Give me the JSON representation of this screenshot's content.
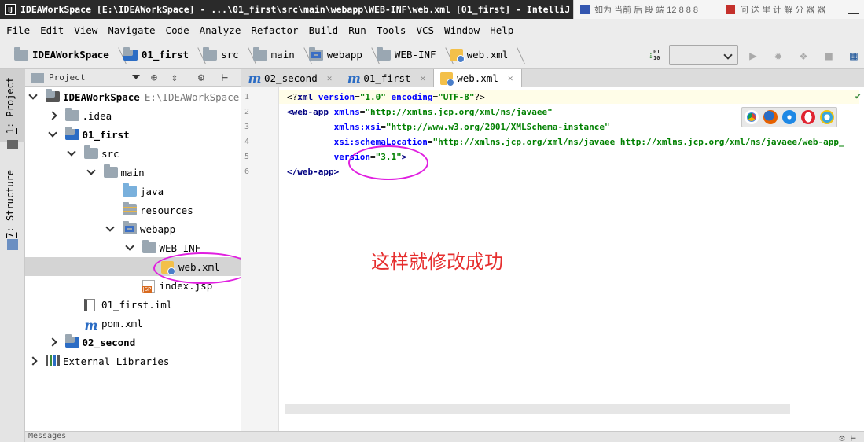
{
  "window": {
    "title": "IDEAWorkSpace [E:\\IDEAWorkSpace] - ...\\01_first\\src\\main\\webapp\\WEB-INF\\web.xml [01_first] - IntelliJ IDEA",
    "app_icon_label": "IJ",
    "background_tabs": [
      "如为 当前 后 段 端 12 8 8 8",
      "问 送 里 计 解 分 器 器"
    ]
  },
  "menu": {
    "items": [
      {
        "label": "File",
        "mnemonic": "F"
      },
      {
        "label": "Edit",
        "mnemonic": "E"
      },
      {
        "label": "View",
        "mnemonic": "V"
      },
      {
        "label": "Navigate",
        "mnemonic": "N"
      },
      {
        "label": "Code",
        "mnemonic": "C"
      },
      {
        "label": "Analyze",
        "mnemonic": "z"
      },
      {
        "label": "Refactor",
        "mnemonic": "R"
      },
      {
        "label": "Build",
        "mnemonic": "B"
      },
      {
        "label": "Run",
        "mnemonic": "u"
      },
      {
        "label": "Tools",
        "mnemonic": "T"
      },
      {
        "label": "VCS",
        "mnemonic": "S"
      },
      {
        "label": "Window",
        "mnemonic": "W"
      },
      {
        "label": "Help",
        "mnemonic": "H"
      }
    ]
  },
  "breadcrumbs": [
    {
      "label": "IDEAWorkSpace",
      "bold": true,
      "icon": "folder-icon"
    },
    {
      "label": "01_first",
      "bold": true,
      "icon": "module-folder-icon"
    },
    {
      "label": "src",
      "bold": false,
      "icon": "folder-icon"
    },
    {
      "label": "main",
      "bold": false,
      "icon": "folder-icon"
    },
    {
      "label": "webapp",
      "bold": false,
      "icon": "web-folder-icon"
    },
    {
      "label": "WEB-INF",
      "bold": false,
      "icon": "folder-icon"
    },
    {
      "label": "web.xml",
      "bold": false,
      "icon": "xml-file-icon"
    }
  ],
  "tool_windows": {
    "project_tab": {
      "number": "1",
      "label": ": Project"
    },
    "structure_tab": {
      "number": "7",
      "label": ": Structure"
    }
  },
  "project_panel": {
    "title": "Project",
    "tree": [
      {
        "label": "IDEAWorkSpace",
        "path": "E:\\IDEAWorkSpace",
        "depth": 0,
        "expanded": true,
        "bold": true,
        "icon": "project-folder-icon"
      },
      {
        "label": ".idea",
        "depth": 1,
        "expanded": false,
        "bold": false,
        "icon": "folder-icon"
      },
      {
        "label": "01_first",
        "depth": 1,
        "expanded": true,
        "bold": true,
        "icon": "module-folder-icon"
      },
      {
        "label": "src",
        "depth": 2,
        "expanded": true,
        "bold": false,
        "icon": "folder-icon"
      },
      {
        "label": "main",
        "depth": 3,
        "expanded": true,
        "bold": false,
        "icon": "folder-icon"
      },
      {
        "label": "java",
        "depth": 4,
        "expanded": null,
        "bold": false,
        "icon": "source-folder-icon"
      },
      {
        "label": "resources",
        "depth": 4,
        "expanded": null,
        "bold": false,
        "icon": "resources-folder-icon"
      },
      {
        "label": "webapp",
        "depth": 4,
        "expanded": true,
        "bold": false,
        "icon": "web-folder-icon"
      },
      {
        "label": "WEB-INF",
        "depth": 5,
        "expanded": true,
        "bold": false,
        "icon": "folder-icon"
      },
      {
        "label": "web.xml",
        "depth": 6,
        "expanded": null,
        "bold": false,
        "icon": "xml-file-icon",
        "selected": true
      },
      {
        "label": "index.jsp",
        "depth": 5,
        "expanded": null,
        "bold": false,
        "icon": "jsp-file-icon"
      },
      {
        "label": "01_first.iml",
        "depth": 2,
        "expanded": null,
        "bold": false,
        "icon": "iml-file-icon"
      },
      {
        "label": "pom.xml",
        "depth": 2,
        "expanded": null,
        "bold": false,
        "icon": "maven-icon"
      },
      {
        "label": "02_second",
        "depth": 1,
        "expanded": false,
        "bold": true,
        "icon": "module-folder-icon"
      },
      {
        "label": "External Libraries",
        "depth": 0,
        "expanded": false,
        "bold": false,
        "icon": "library-icon"
      }
    ]
  },
  "editor_tabs": [
    {
      "label": "02_second",
      "icon": "maven-icon",
      "active": false
    },
    {
      "label": "01_first",
      "icon": "maven-icon",
      "active": false
    },
    {
      "label": "web.xml",
      "icon": "xml-file-icon",
      "active": true
    }
  ],
  "editor": {
    "line_numbers": [
      "1",
      "2",
      "3",
      "4",
      "5",
      "6"
    ],
    "lines": [
      [
        {
          "t": "pi",
          "s": "<?"
        },
        {
          "t": "tag",
          "s": "xml "
        },
        {
          "t": "attr",
          "s": "version"
        },
        {
          "t": "pi",
          "s": "="
        },
        {
          "t": "val",
          "s": "\"1.0\""
        },
        {
          "t": "pi",
          "s": " "
        },
        {
          "t": "attr",
          "s": "encoding"
        },
        {
          "t": "pi",
          "s": "="
        },
        {
          "t": "val",
          "s": "\"UTF-8\""
        },
        {
          "t": "pi",
          "s": "?>"
        }
      ],
      [
        {
          "t": "tag",
          "s": "<web-app "
        },
        {
          "t": "attr",
          "s": "xmlns"
        },
        {
          "t": "pi",
          "s": "="
        },
        {
          "t": "val",
          "s": "\"http://xmlns.jcp.org/xml/ns/javaee\""
        }
      ],
      [
        {
          "t": "pi",
          "s": "         "
        },
        {
          "t": "attr",
          "s": "xmlns:xsi"
        },
        {
          "t": "pi",
          "s": "="
        },
        {
          "t": "val",
          "s": "\"http://www.w3.org/2001/XMLSchema-instance\""
        }
      ],
      [
        {
          "t": "pi",
          "s": "         "
        },
        {
          "t": "attr",
          "s": "xsi:schemaLocation"
        },
        {
          "t": "pi",
          "s": "="
        },
        {
          "t": "val",
          "s": "\"http://xmlns.jcp.org/xml/ns/javaee http://xmlns.jcp.org/xml/ns/javaee/web-app_"
        }
      ],
      [
        {
          "t": "pi",
          "s": "         "
        },
        {
          "t": "attr",
          "s": "version"
        },
        {
          "t": "pi",
          "s": "="
        },
        {
          "t": "val",
          "s": "\"3.1\""
        },
        {
          "t": "tag",
          "s": ">"
        }
      ],
      [
        {
          "t": "tag",
          "s": "</web-app>"
        }
      ]
    ],
    "annotation": "这样就修改成功",
    "browsers": [
      "chrome-icon",
      "firefox-icon",
      "safari-icon",
      "opera-icon",
      "ie-icon"
    ]
  },
  "bottom": {
    "label": "Messages"
  },
  "colors": {
    "highlight": "#e01fe0",
    "annotation": "#e62e2e",
    "xml_value": "#008000",
    "xml_attr": "#0000ff",
    "xml_tag": "#000080"
  }
}
